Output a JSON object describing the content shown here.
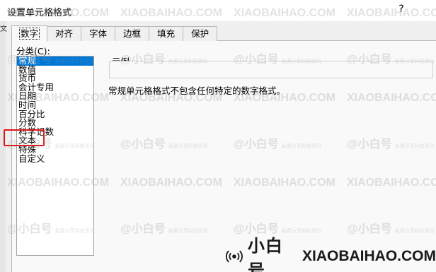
{
  "window": {
    "title": "设置单元格格式",
    "help_label": "?",
    "left_edge_char": "文"
  },
  "tabs": [
    {
      "label": "数字",
      "active": true
    },
    {
      "label": "对齐",
      "active": false
    },
    {
      "label": "字体",
      "active": false
    },
    {
      "label": "边框",
      "active": false
    },
    {
      "label": "填充",
      "active": false
    },
    {
      "label": "保护",
      "active": false
    }
  ],
  "category": {
    "label": "分类(C):",
    "items": [
      "常规",
      "数值",
      "货币",
      "会计专用",
      "日期",
      "时间",
      "百分比",
      "分数",
      "科学记数",
      "文本",
      "特殊",
      "自定义"
    ],
    "selected_index": 0
  },
  "sample": {
    "label": "示例",
    "value": ""
  },
  "description": "常规单元格格式不包含任何特定的数字格式。",
  "watermark": {
    "cn": "@小白号",
    "en": "XIAOBAIHAO.COM",
    "small": "免费分享科技资讯"
  },
  "brand": {
    "cn": "小白号",
    "en": "XIAOBAIHAO.COM"
  },
  "colors": {
    "selection": "#0078d7",
    "highlight_border": "#e0161a"
  }
}
